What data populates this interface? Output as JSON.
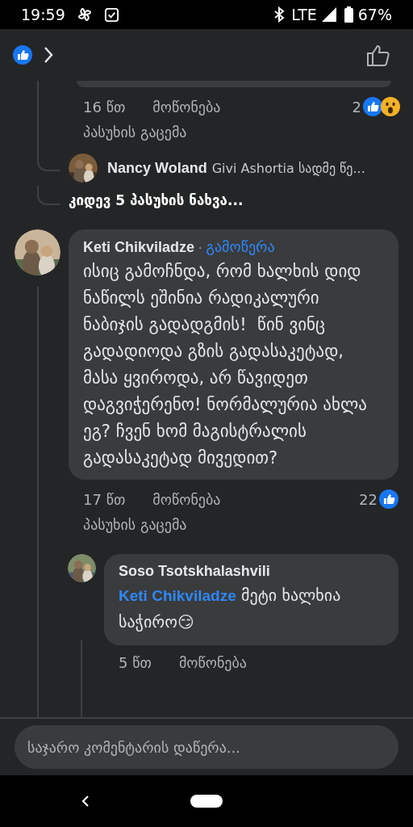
{
  "status_bar": {
    "time": "19:59",
    "network": "LTE",
    "battery": "67%"
  },
  "earlier_reply_actions": {
    "time": "16 წთ",
    "like_label": "მოწონება",
    "reply_label": "პასუხის გაცემა",
    "reaction_count": "2"
  },
  "reply_preview": {
    "author": "Nancy Woland",
    "text": "Givi Ashortia სადმე წე..."
  },
  "more_replies": "კიდევ 5 პასუხის ნახვა...",
  "comment": {
    "author": "Keti Chikviladze",
    "separator": "·",
    "follow_label": "გამოწერა",
    "text": "ისიც გამოჩნდა, რომ ხალხის დიდ ნაწილს ეშინია რადიკალური ნაბიჯის გადადგმის!  წინ ვინც გადადიოდა გზის გადასაკეტად, მასა ყვიროდა, არ წავიდეთ დაგვიჭერენო! ნორმალურია ახლა ეგ? ჩვენ ხომ მაგისტრალის გადასაკეტად მივედით?",
    "time": "17 წთ",
    "like_label": "მოწონება",
    "reply_label": "პასუხის გაცემა",
    "reaction_count": "22"
  },
  "reply": {
    "author": "Soso Tsotskhalashvili",
    "mention": "Keti Chikviladze",
    "text": "მეტი ხალხია საჭირო😏",
    "time": "5 წთ",
    "like_label": "მოწონება"
  },
  "composer": {
    "placeholder": "საჯარო კომენტარის დაწერა..."
  }
}
